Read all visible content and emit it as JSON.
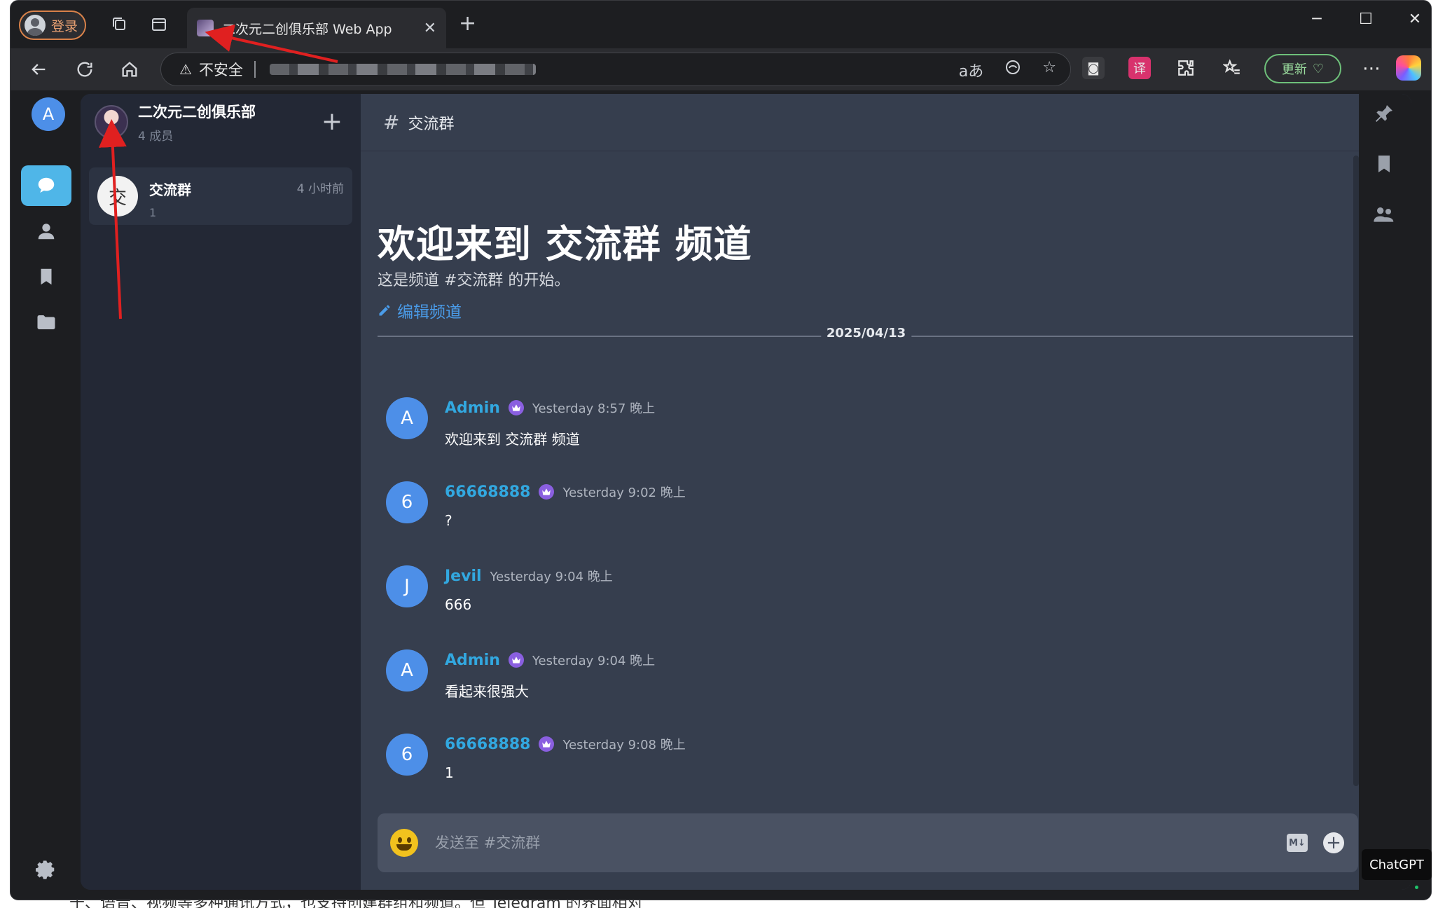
{
  "browser": {
    "profile_label": "登录",
    "tab_title": "二次元二创俱乐部 Web App",
    "insecure_label": "不安全",
    "update_label": "更新"
  },
  "rail": {
    "avatar_letter": "A"
  },
  "group": {
    "name": "二次元二创俱乐部",
    "members": "4 成员"
  },
  "channel_list": [
    {
      "avatar_char": "交",
      "name": "交流群",
      "sub": "1",
      "time": "4 小时前"
    }
  ],
  "channel": {
    "header": "交流群",
    "welcome_title": "欢迎来到 交流群 频道",
    "welcome_sub": "这是频道 #交流群 的开始。",
    "edit_label": "编辑频道",
    "date": "2025/04/13"
  },
  "messages": [
    {
      "avatar": "A",
      "name": "Admin",
      "crown": true,
      "time": "Yesterday 8:57 晚上",
      "text": "欢迎来到 交流群 频道"
    },
    {
      "avatar": "6",
      "name": "66668888",
      "crown": true,
      "time": "Yesterday 9:02 晚上",
      "text": "?"
    },
    {
      "avatar": "J",
      "name": "Jevil",
      "crown": false,
      "time": "Yesterday 9:04 晚上",
      "text": "666"
    },
    {
      "avatar": "A",
      "name": "Admin",
      "crown": true,
      "time": "Yesterday 9:04 晚上",
      "text": "看起来很强大"
    },
    {
      "avatar": "6",
      "name": "66668888",
      "crown": true,
      "time": "Yesterday 9:08 晚上",
      "text": "1"
    }
  ],
  "composer": {
    "placeholder": "发送至 #交流群"
  },
  "overlay": {
    "chatgpt_label": "ChatGPT"
  },
  "colors": {
    "accent_blue": "#4fb6e8",
    "username": "#32a8e0",
    "link": "#4a9be8",
    "crown": "#8a5fe0",
    "annotation": "#e02020"
  }
}
